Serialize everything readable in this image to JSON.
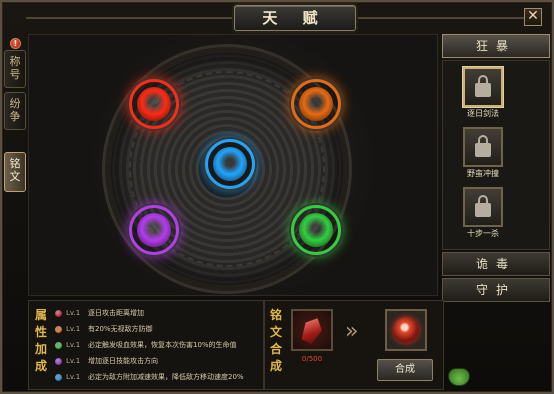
{
  "window": {
    "title": "天 赋",
    "close_label": "✕"
  },
  "side_tabs": [
    {
      "label": "称号"
    },
    {
      "label": "纷争"
    },
    {
      "label": "铭文",
      "active": true
    }
  ],
  "side_alert": "!",
  "talent_orbs": [
    {
      "name": "red",
      "color": "#ff2a14"
    },
    {
      "name": "orange",
      "color": "#e86a10"
    },
    {
      "name": "blue",
      "color": "#1ea6ff"
    },
    {
      "name": "purple",
      "color": "#b43cf0"
    },
    {
      "name": "green",
      "color": "#2fd040"
    }
  ],
  "right_panel": {
    "tabs": [
      "狂暴",
      "诡毒",
      "守护"
    ],
    "active_tab": 0,
    "skills": [
      {
        "name": "逐日剑法",
        "selected": true
      },
      {
        "name": "野蛮冲撞",
        "selected": false
      },
      {
        "name": "十步一杀",
        "selected": false
      }
    ]
  },
  "attributes": {
    "heading": "属性加成",
    "rows": [
      {
        "level": "Lv.1",
        "text": "逐日攻击距离增加",
        "gem_color": "#e0304a"
      },
      {
        "level": "Lv.1",
        "text": "有20%无视敌方防御",
        "gem_color": "#ff7a2a"
      },
      {
        "level": "Lv.1",
        "text": "必定触发吸血效果，恢复本次伤害10%的生命值",
        "gem_color": "#3fd44a"
      },
      {
        "level": "Lv.1",
        "text": "增加逐日技能攻击方向",
        "gem_color": "#b040e8"
      },
      {
        "level": "Lv.1",
        "text": "必定为敌方附加减速效果，降低敌方移动速度20%",
        "gem_color": "#2a9ef0"
      }
    ]
  },
  "synthesis": {
    "heading": "铭文合成",
    "material_count": "0/500",
    "arrow": "»",
    "button_label": "合成"
  }
}
